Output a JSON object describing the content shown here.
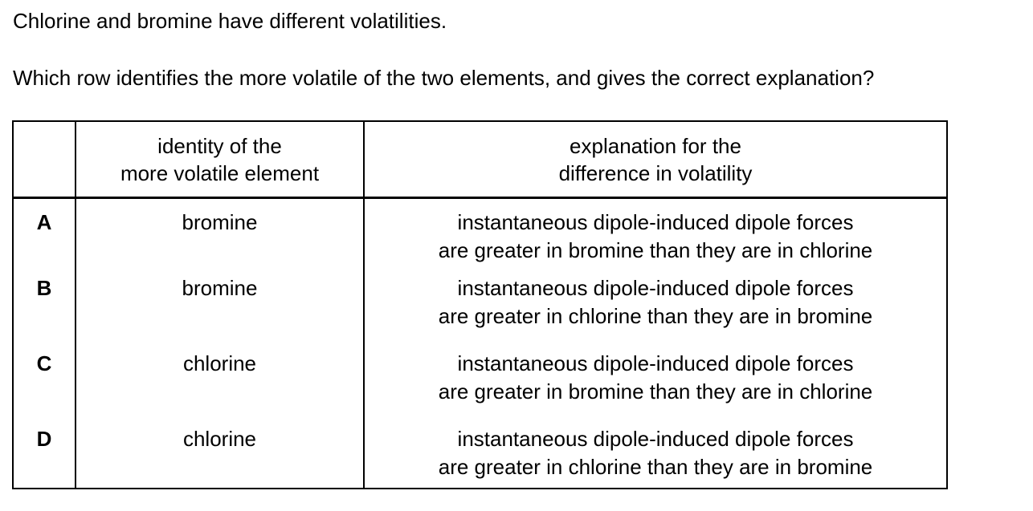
{
  "intro": "Chlorine and bromine have different volatilities.",
  "question": "Which row identifies the more volatile of the two elements, and gives the correct explanation?",
  "table": {
    "headers": {
      "identity": [
        "identity of the",
        "more volatile element"
      ],
      "explanation": [
        "explanation for the",
        "difference in volatility"
      ]
    },
    "rows": [
      {
        "letter": "A",
        "identity": "bromine",
        "explanation": [
          "instantaneous dipole-induced dipole forces",
          "are greater in bromine than they are in chlorine"
        ]
      },
      {
        "letter": "B",
        "identity": "bromine",
        "explanation": [
          "instantaneous dipole-induced dipole forces",
          "are greater in chlorine than they are in bromine"
        ]
      },
      {
        "letter": "C",
        "identity": "chlorine",
        "explanation": [
          "instantaneous dipole-induced dipole forces",
          "are greater in bromine than they are in chlorine"
        ]
      },
      {
        "letter": "D",
        "identity": "chlorine",
        "explanation": [
          "instantaneous dipole-induced dipole forces",
          "are greater in chlorine than they are in bromine"
        ]
      }
    ]
  }
}
